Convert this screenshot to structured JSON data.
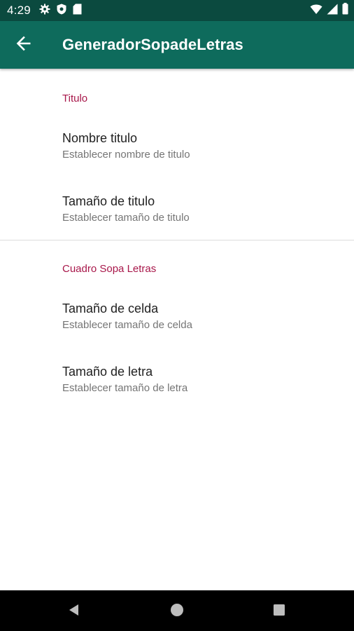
{
  "status_bar": {
    "time": "4:29",
    "left_icons": [
      "gear-icon",
      "shield-icon",
      "sd-card-icon"
    ],
    "right_icons": [
      "wifi-icon",
      "cellular-signal-icon",
      "battery-icon"
    ]
  },
  "app_bar": {
    "title": "GeneradorSopadeLetras",
    "back_icon": "arrow-back-icon",
    "background": "#0e6b5c"
  },
  "categories": [
    {
      "title": "Titulo",
      "items": [
        {
          "title": "Nombre titulo",
          "summary": "Establecer nombre de titulo"
        },
        {
          "title": "Tamaño de titulo",
          "summary": "Establecer tamaño de titulo"
        }
      ]
    },
    {
      "title": "Cuadro Sopa Letras",
      "items": [
        {
          "title": "Tamaño de celda",
          "summary": "Establecer tamaño de celda"
        },
        {
          "title": "Tamaño de letra",
          "summary": "Establecer tamaño de letra"
        }
      ]
    }
  ],
  "colors": {
    "status_bar": "#0b4a3f",
    "accent": "#a8174a",
    "primary_text": "#212121",
    "secondary_text": "#757575"
  },
  "nav_bar": {
    "buttons": [
      "back-triangle-icon",
      "home-circle-icon",
      "recents-square-icon"
    ]
  }
}
